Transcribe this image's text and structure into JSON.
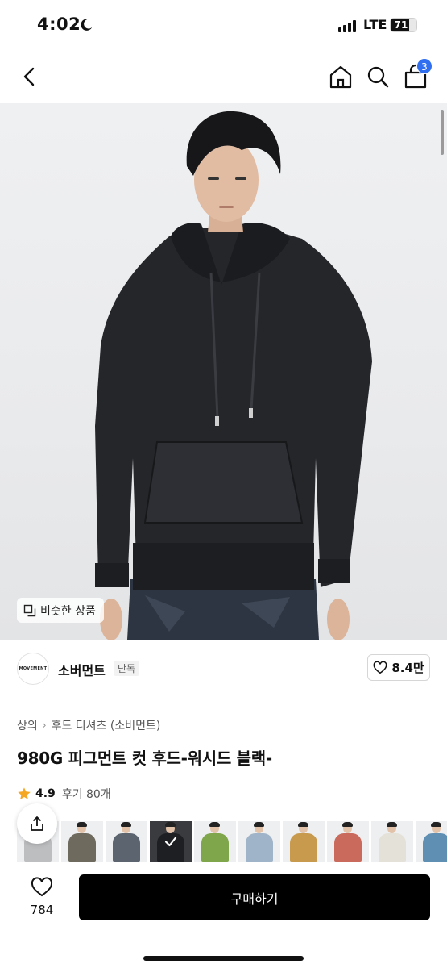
{
  "status": {
    "time": "4:02",
    "network": "LTE",
    "battery": "71",
    "battery_level": 0.71
  },
  "nav": {
    "icons": [
      "back-icon",
      "home-icon",
      "search-icon",
      "cart-icon"
    ],
    "cart_count": "3"
  },
  "hero": {
    "similar_label": "비슷한 상품"
  },
  "brand": {
    "logo_text": "MOVEMENT",
    "name": "소버먼트",
    "badge": "단독",
    "like_count": "8.4만"
  },
  "breadcrumb": [
    "상의",
    "후드 티셔츠 (소버먼트)"
  ],
  "product": {
    "title": "980G 피그먼트 컷 후드-워시드 블랙-",
    "rating": "4.9",
    "review_label": "후기 80개"
  },
  "swatches": [
    {
      "color": "#bdbec0"
    },
    {
      "color": "#6e6a5e"
    },
    {
      "color": "#5c6470"
    },
    {
      "color": "#1e1f22",
      "selected": true
    },
    {
      "color": "#7fa64a"
    },
    {
      "color": "#9fb4c8"
    },
    {
      "color": "#c79a4e"
    },
    {
      "color": "#c96a5c"
    },
    {
      "color": "#e4e1d8"
    },
    {
      "color": "#5f90b4"
    },
    {
      "color": "#8a9a6e"
    }
  ],
  "bottom": {
    "wish_count": "784",
    "buy_label": "구매하기"
  },
  "colors": {
    "accent": "#2f6ff0",
    "primary_button": "#000000"
  }
}
